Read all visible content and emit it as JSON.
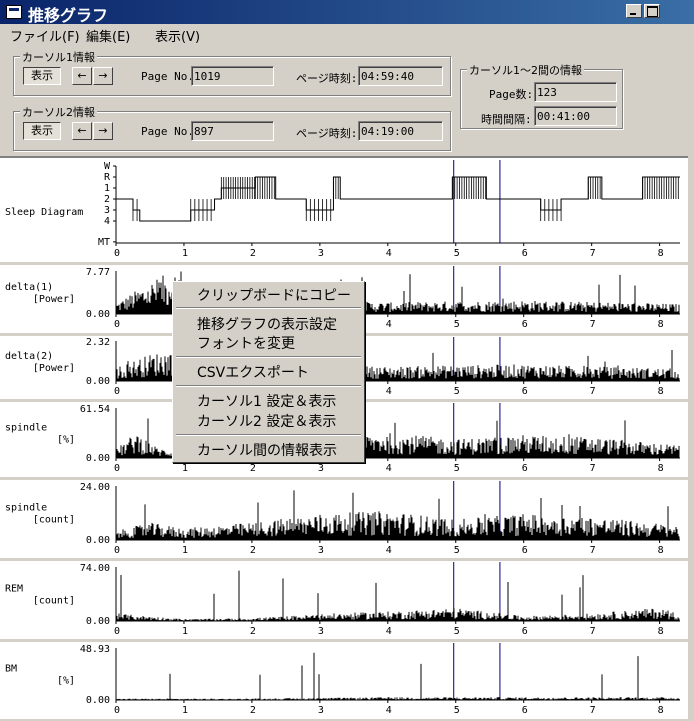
{
  "window": {
    "title": "推移グラフ"
  },
  "menu": [
    "ファイル(F)",
    "編集(E)",
    "表示(V)"
  ],
  "cursor1": {
    "group_label": "カーソル1情報",
    "show_button": "表示",
    "left_button": "←",
    "right_button": "→",
    "page_no_label": "Page No.:",
    "page_no": "1019",
    "page_time_label": "ページ時刻:",
    "page_time": "04:59:40"
  },
  "cursor2": {
    "group_label": "カーソル2情報",
    "show_button": "表示",
    "left_button": "←",
    "right_button": "→",
    "page_no_label": "Page No.:",
    "page_no": "897",
    "page_time_label": "ページ時刻:",
    "page_time": "04:19:00"
  },
  "between": {
    "group_label": "カーソル1～2間の情報",
    "pages_label": "Page数:",
    "pages": "123",
    "interval_label": "時間間隔:",
    "interval": "00:41:00"
  },
  "context_menu": [
    "クリップボードにコピー",
    "推移グラフの表示設定",
    "フォントを変更",
    "CSVエクスポート",
    "カーソル1 設定＆表示",
    "カーソル2 設定＆表示",
    "カーソル間の情報表示"
  ],
  "colors": {
    "titlebar": "#0a246a",
    "cursor_line": "#000080",
    "bars": "#000000"
  },
  "icons": {
    "window": "app-icon",
    "minimize": "minimize-icon",
    "maximize": "maximize-icon"
  },
  "chart_data": [
    {
      "type": "line",
      "label": "Sleep Diagram",
      "xlabel": "",
      "xlim": [
        0,
        8.3
      ],
      "x_ticks": [
        "0",
        "1",
        "2",
        "3",
        "4",
        "5",
        "6",
        "7",
        "8"
      ],
      "stage_labels": [
        "W",
        "R",
        "1",
        "2",
        "3",
        "4",
        "MT"
      ],
      "cursor_positions": [
        4.97,
        5.65
      ],
      "segments": [
        {
          "x0": 0.0,
          "x1": 0.25,
          "stage": "2"
        },
        {
          "x0": 0.25,
          "x1": 0.35,
          "stage": "3"
        },
        {
          "x0": 0.35,
          "x1": 1.1,
          "stage": "4"
        },
        {
          "x0": 1.1,
          "x1": 1.45,
          "stage": "3"
        },
        {
          "x0": 1.45,
          "x1": 1.55,
          "stage": "2"
        },
        {
          "x0": 1.55,
          "x1": 2.05,
          "stage": "1"
        },
        {
          "x0": 2.05,
          "x1": 2.35,
          "stage": "R"
        },
        {
          "x0": 2.35,
          "x1": 2.8,
          "stage": "2"
        },
        {
          "x0": 2.8,
          "x1": 3.2,
          "stage": "3"
        },
        {
          "x0": 3.2,
          "x1": 3.3,
          "stage": "R"
        },
        {
          "x0": 3.3,
          "x1": 3.7,
          "stage": "2"
        },
        {
          "x0": 3.7,
          "x1": 4.95,
          "stage": "2"
        },
        {
          "x0": 4.95,
          "x1": 5.45,
          "stage": "R"
        },
        {
          "x0": 5.45,
          "x1": 6.25,
          "stage": "2"
        },
        {
          "x0": 6.25,
          "x1": 6.55,
          "stage": "3"
        },
        {
          "x0": 6.55,
          "x1": 6.95,
          "stage": "2"
        },
        {
          "x0": 6.95,
          "x1": 7.15,
          "stage": "R"
        },
        {
          "x0": 7.15,
          "x1": 7.75,
          "stage": "2"
        },
        {
          "x0": 7.75,
          "x1": 8.3,
          "stage": "R"
        }
      ]
    },
    {
      "type": "bar",
      "label": "delta(1)",
      "unit": "[Power]",
      "ymax_label": "7.77",
      "ymin_label": "0.00",
      "ylim": [
        0,
        7.77
      ],
      "xlim": [
        0,
        8.3
      ],
      "x_ticks": [
        "0",
        "1",
        "2",
        "3",
        "4",
        "5",
        "6",
        "7",
        "8"
      ],
      "envelope": [
        {
          "x": 0.0,
          "y": 1.5
        },
        {
          "x": 0.5,
          "y": 4.5
        },
        {
          "x": 0.95,
          "y": 6.5
        },
        {
          "x": 1.1,
          "y": 3.0
        },
        {
          "x": 2.0,
          "y": 1.5
        },
        {
          "x": 3.0,
          "y": 2.0
        },
        {
          "x": 4.0,
          "y": 1.6
        },
        {
          "x": 5.0,
          "y": 1.8
        },
        {
          "x": 6.0,
          "y": 1.9
        },
        {
          "x": 7.0,
          "y": 1.7
        },
        {
          "x": 8.3,
          "y": 1.4
        }
      ]
    },
    {
      "type": "bar",
      "label": "delta(2)",
      "unit": "[Power]",
      "ymax_label": "2.32",
      "ymin_label": "0.00",
      "ylim": [
        0,
        2.32
      ],
      "xlim": [
        0,
        8.3
      ],
      "x_ticks": [
        "0",
        "1",
        "2",
        "3",
        "4",
        "5",
        "6",
        "7",
        "8"
      ],
      "envelope": [
        {
          "x": 0.0,
          "y": 0.6
        },
        {
          "x": 0.5,
          "y": 1.2
        },
        {
          "x": 0.95,
          "y": 1.5
        },
        {
          "x": 1.1,
          "y": 0.9
        },
        {
          "x": 2.0,
          "y": 0.6
        },
        {
          "x": 3.0,
          "y": 0.7
        },
        {
          "x": 4.0,
          "y": 0.65
        },
        {
          "x": 5.0,
          "y": 0.7
        },
        {
          "x": 6.0,
          "y": 0.75
        },
        {
          "x": 7.0,
          "y": 0.65
        },
        {
          "x": 8.3,
          "y": 0.55
        }
      ]
    },
    {
      "type": "bar",
      "label": "spindle",
      "unit": "[%]",
      "ymax_label": "61.54",
      "ymin_label": "0.00",
      "ylim": [
        0,
        61.54
      ],
      "xlim": [
        0,
        8.3
      ],
      "x_ticks": [
        "0",
        "1",
        "2",
        "3",
        "4",
        "5",
        "6",
        "7",
        "8"
      ],
      "envelope": [
        {
          "x": 0.0,
          "y": 8
        },
        {
          "x": 0.3,
          "y": 25
        },
        {
          "x": 0.6,
          "y": 10
        },
        {
          "x": 1.0,
          "y": 5
        },
        {
          "x": 2.0,
          "y": 15
        },
        {
          "x": 3.0,
          "y": 20
        },
        {
          "x": 4.0,
          "y": 24
        },
        {
          "x": 5.0,
          "y": 18
        },
        {
          "x": 6.0,
          "y": 22
        },
        {
          "x": 7.0,
          "y": 20
        },
        {
          "x": 8.3,
          "y": 12
        }
      ]
    },
    {
      "type": "bar",
      "label": "spindle",
      "unit": "[count]",
      "ymax_label": "24.00",
      "ymin_label": "0.00",
      "ylim": [
        0,
        24
      ],
      "xlim": [
        0,
        8.3
      ],
      "x_ticks": [
        "0",
        "1",
        "2",
        "3",
        "4",
        "5",
        "6",
        "7",
        "8"
      ],
      "envelope": [
        {
          "x": 0.0,
          "y": 3
        },
        {
          "x": 0.5,
          "y": 6
        },
        {
          "x": 1.0,
          "y": 4
        },
        {
          "x": 2.0,
          "y": 6
        },
        {
          "x": 3.0,
          "y": 9
        },
        {
          "x": 4.0,
          "y": 10
        },
        {
          "x": 5.0,
          "y": 7
        },
        {
          "x": 6.0,
          "y": 9
        },
        {
          "x": 7.0,
          "y": 8
        },
        {
          "x": 8.3,
          "y": 5
        }
      ]
    },
    {
      "type": "bar",
      "label": "REM",
      "unit": "[count]",
      "ymax_label": "74.00",
      "ymin_label": "0.00",
      "ylim": [
        0,
        74
      ],
      "xlim": [
        0,
        8.3
      ],
      "x_ticks": [
        "0",
        "1",
        "2",
        "3",
        "4",
        "5",
        "6",
        "7",
        "8"
      ],
      "envelope": [
        {
          "x": 0.0,
          "y": 8
        },
        {
          "x": 1.0,
          "y": 2
        },
        {
          "x": 2.0,
          "y": 3
        },
        {
          "x": 3.2,
          "y": 8
        },
        {
          "x": 4.0,
          "y": 10
        },
        {
          "x": 5.0,
          "y": 14
        },
        {
          "x": 6.0,
          "y": 5
        },
        {
          "x": 7.0,
          "y": 8
        },
        {
          "x": 8.0,
          "y": 14
        },
        {
          "x": 8.3,
          "y": 8
        }
      ]
    },
    {
      "type": "bar",
      "label": "BM",
      "unit": "[%]",
      "ymax_label": "48.93",
      "ymin_label": "0.00",
      "ylim": [
        0,
        48.93
      ],
      "xlim": [
        0,
        8.3
      ],
      "x_ticks": [
        "0",
        "1",
        "2",
        "3",
        "4",
        "5",
        "6",
        "7",
        "8"
      ],
      "envelope": [
        {
          "x": 0.0,
          "y": 1
        },
        {
          "x": 2.0,
          "y": 1
        },
        {
          "x": 4.0,
          "y": 2
        },
        {
          "x": 6.0,
          "y": 2
        },
        {
          "x": 8.3,
          "y": 2
        }
      ]
    }
  ]
}
